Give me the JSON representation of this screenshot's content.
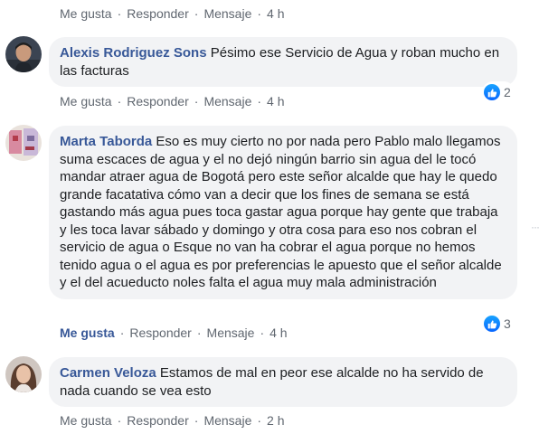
{
  "top_actions": {
    "like": "Me gusta",
    "reply": "Responder",
    "message": "Mensaje",
    "time": "4 h"
  },
  "comments": [
    {
      "author": "Alexis Rodriguez Sons",
      "text": "Pésimo ese Servicio de Agua y roban mucho en las facturas",
      "reactions": "2",
      "actions": {
        "like": "Me gusta",
        "reply": "Responder",
        "message": "Mensaje",
        "time": "4 h"
      },
      "liked": false
    },
    {
      "author": "Marta Taborda",
      "text": "Eso es muy cierto no por nada pero Pablo malo llegamos suma escaces de agua y el no dejó ningún barrio sin agua del le tocó mandar atraer agua de Bogotá pero este señor alcalde que hay le quedo grande facatativa cómo van a decir que los fines de semana se está gastando más agua pues toca gastar agua porque hay gente que trabaja y les toca lavar sábado y domingo y otra cosa para eso nos cobran el servicio de agua o Esque no van ha cobrar el agua porque no hemos tenido agua o el agua es por preferencias le apuesto que el señor alcalde y el del acueducto noles falta el agua muy mala administración",
      "reactions": "3",
      "actions": {
        "like": "Me gusta",
        "reply": "Responder",
        "message": "Mensaje",
        "time": "4 h"
      },
      "liked": true
    },
    {
      "author": "Carmen Veloza",
      "text": "Estamos de mal en peor ese alcalde no ha servido de nada cuando se vea esto",
      "actions": {
        "like": "Me gusta",
        "reply": "Responder",
        "message": "Mensaje",
        "time": "2 h"
      },
      "liked": false
    }
  ],
  "colors": {
    "author": "#385898",
    "bubble": "#f2f3f5",
    "meta": "#606770",
    "like_blue": "#1877f2"
  }
}
